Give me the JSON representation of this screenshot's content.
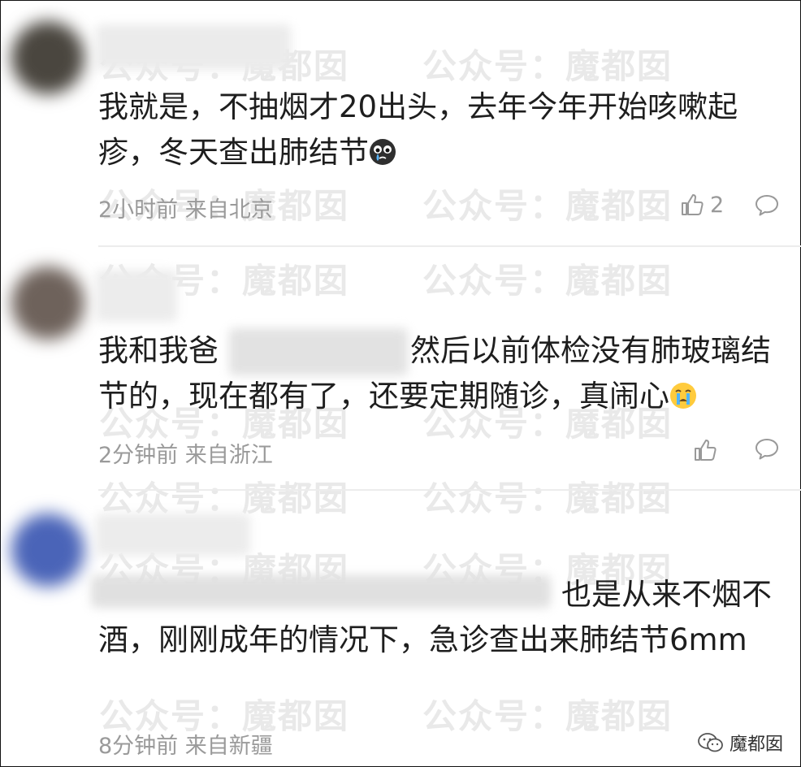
{
  "comments": [
    {
      "text_before": "我就是，不抽烟才20出头，去年今年开始咳嗽起疹，冬天查出肺结节",
      "text_after": "",
      "emoji": "sobbing-face",
      "meta": "2小时前 来自北京",
      "likes": "2"
    },
    {
      "text_before": "我和我爸",
      "text_after": "然后以前体检没有肺玻璃结节的，现在都有了，还要定期随诊，真闹心",
      "emoji": "crying-face",
      "meta": "2分钟前 来自浙江",
      "likes": ""
    },
    {
      "text_before": "",
      "text_after": "也是从来不烟不酒，刚刚成年的情况下，急诊查出来肺结节6mm",
      "emoji": "",
      "meta": "8分钟前 来自新疆",
      "likes": ""
    }
  ],
  "watermark": {
    "left": "公众号：",
    "right": "魔都囡"
  },
  "brand": "魔都囡",
  "colors": {
    "text": "#1e1e1e",
    "meta": "#9a9a9a",
    "watermark": "#e9e9e9",
    "divider": "#ececec"
  }
}
